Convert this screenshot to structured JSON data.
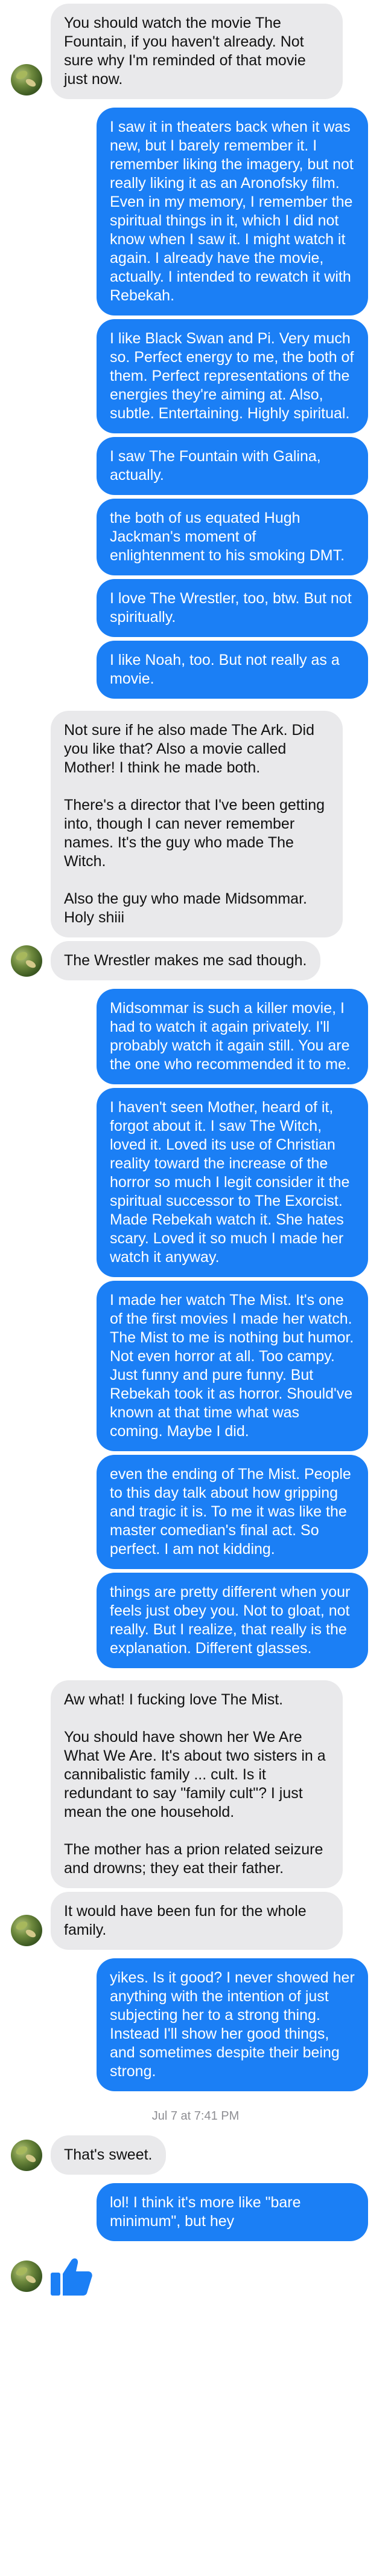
{
  "messages": [
    {
      "side": "in",
      "texts": [
        "You should watch the movie The Fountain, if you haven't already. Not sure why I'm reminded of that movie just now."
      ]
    },
    {
      "side": "out",
      "texts": [
        "I saw it in theaters back when it was new, but I barely remember it. I remember liking the imagery, but not really liking it as an Aronofsky film. Even in my memory, I remember the spiritual things in it, which I did not know when I saw it. I might watch it again. I already have the movie, actually. I intended to rewatch it with Rebekah.",
        "I like Black Swan and Pi. Very much so. Perfect energy to me, the both of them. Perfect representations of the energies they're aiming at. Also, subtle. Entertaining. Highly spiritual.",
        "I saw The Fountain with Galina, actually.",
        "the both of us equated Hugh Jackman's moment of enlightenment to his smoking DMT.",
        "I love The Wrestler, too, btw. But not spiritually.",
        "I like Noah, too. But not really as a movie."
      ]
    },
    {
      "side": "in",
      "texts": [
        "Not sure if he also made The Ark. Did you like that? Also a movie called Mother! I think he made both.\n\nThere's a director that I've been getting into, though I can never remember names. It's the guy who made The Witch.\n\nAlso the guy who made Midsommar. Holy shiii",
        "The Wrestler makes me sad though."
      ]
    },
    {
      "side": "out",
      "texts": [
        "Midsommar is such a killer movie, I had to watch it again privately. I'll probably watch it again still. You are the one who recommended it to me.",
        "I haven't seen Mother, heard of it, forgot about it. I saw The Witch, loved it. Loved its use of Christian reality toward the increase of the horror so much I legit consider it the spiritual successor to The Exorcist. Made Rebekah watch it. She hates scary. Loved it so much I made her watch it anyway.",
        "I made her watch The Mist. It's one of the first movies I made her watch. The Mist to me is nothing but humor. Not even horror at all. Too campy. Just funny and pure funny. But Rebekah took it as horror. Should've known at that time what was coming. Maybe I did.",
        "even the ending of The Mist. People to this day talk about how gripping and tragic it is. To me it was like the master comedian's final act. So perfect. I am not kidding.",
        "things are pretty different when your feels just obey you. Not to gloat, not really. But I realize, that really is the explanation. Different glasses."
      ]
    },
    {
      "side": "in",
      "texts": [
        "Aw what! I fucking love The Mist.\n\nYou should have shown her We Are What We Are. It's about two sisters in a cannibalistic family ... cult. Is it redundant to say \"family cult\"? I just mean the one household.\n\nThe mother has a prion related seizure and drowns; they eat their father.",
        "It would have been fun for the whole family."
      ]
    },
    {
      "side": "out",
      "texts": [
        "yikes. Is it good? I never showed her anything with the intention of just subjecting her to a strong thing. Instead I'll show her good things, and sometimes despite their being strong."
      ]
    }
  ],
  "timestamp": "Jul 7 at 7:41 PM",
  "after_timestamp": [
    {
      "side": "in",
      "texts": [
        "That's sweet."
      ]
    },
    {
      "side": "out",
      "texts": [
        "lol! I think it's more like \"bare minimum\", but hey"
      ]
    }
  ],
  "like_icon": "thumbs-up-icon",
  "avatar_icon": "contact-avatar",
  "colors": {
    "outgoing": "#1b7ff5",
    "incoming": "#e9e9eb",
    "timestamp": "#8e8e93"
  }
}
